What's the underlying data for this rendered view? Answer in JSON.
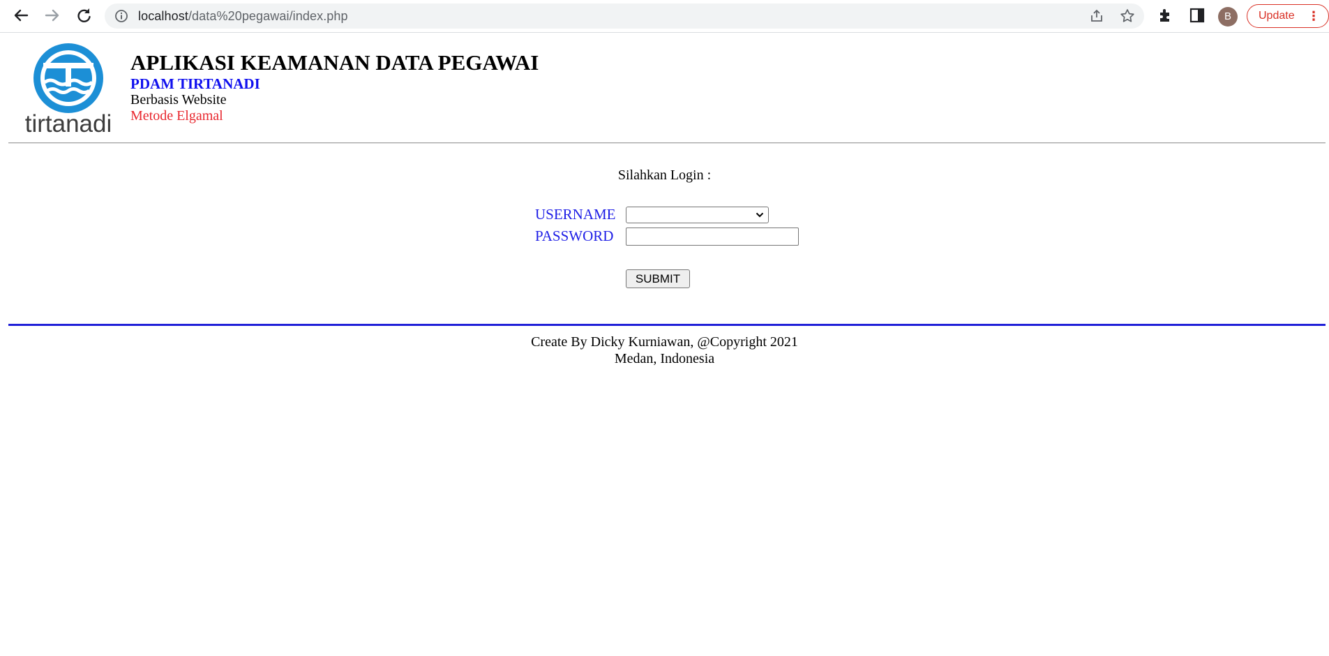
{
  "browser": {
    "url_host": "localhost",
    "url_path": "/data%20pegawai/index.php",
    "profile_initial": "B",
    "update_label": "Update"
  },
  "header": {
    "logo_text": "tirtanadi",
    "title": "APLIKASI KEAMANAN DATA PEGAWAI",
    "subtitle": "PDAM TIRTANADI",
    "line2": "Berbasis Website",
    "line3": "Metode Elgamal"
  },
  "login": {
    "prompt": "Silahkan Login :",
    "username_label": "USERNAME",
    "username_value": "",
    "password_label": "PASSWORD",
    "password_value": "",
    "submit_label": "SUBMIT"
  },
  "footer": {
    "line1": "Create By Dicky Kurniawan, @Copyright 2021",
    "line2": "Medan, Indonesia"
  },
  "colors": {
    "title_blue": "#1010ee",
    "label_blue": "#1e1ee6",
    "red": "#e8262d",
    "rule_blue": "#2020d8",
    "logo_blue": "#1c8fd6"
  }
}
